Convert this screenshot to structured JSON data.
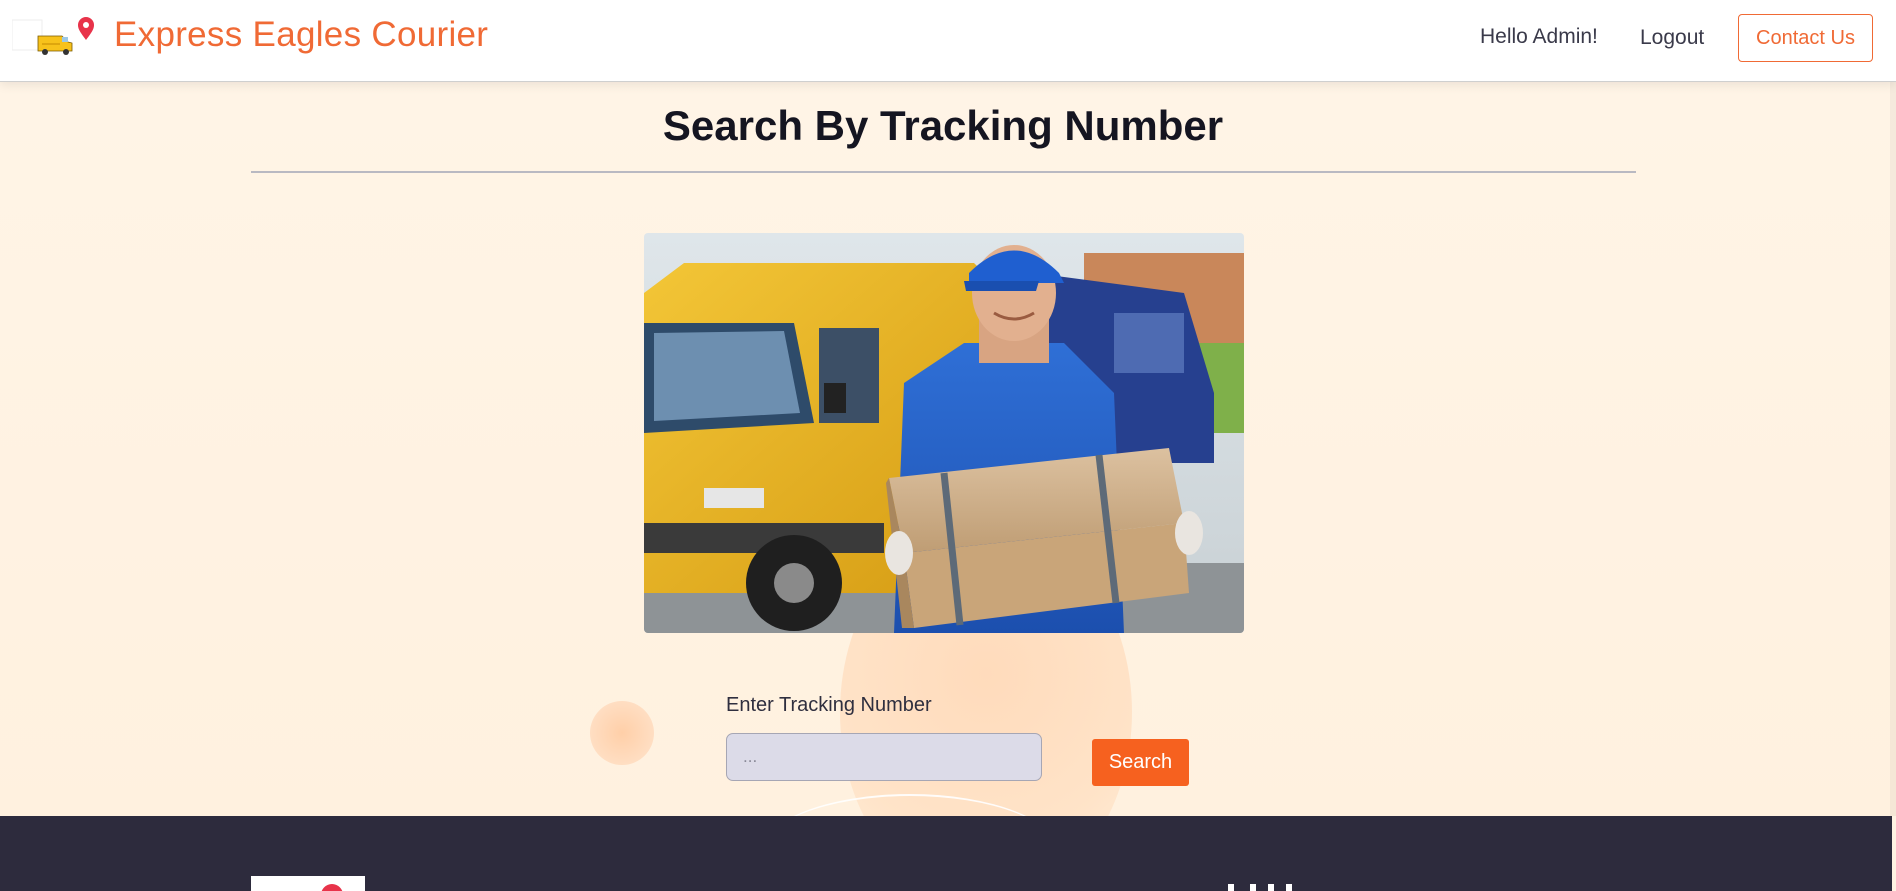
{
  "header": {
    "brand_name": "Express Eagles Courier",
    "logo_icon": "delivery-van-location-pin-logo",
    "greeting": "Hello Admin!",
    "logout_label": "Logout",
    "contact_label": "Contact Us"
  },
  "main": {
    "page_title": "Search By Tracking Number",
    "hero_image": "courier-holding-parcels-in-front-of-yellow-van",
    "form": {
      "label": "Enter Tracking Number",
      "placeholder": "...",
      "value": "",
      "submit_label": "Search"
    }
  },
  "footer": {
    "logo_icon": "footer-brand-logo"
  },
  "colors": {
    "brand": "#f06a35",
    "accent_button": "#f6611f",
    "page_background": "#fff3e2",
    "footer_background": "#2d2b3d",
    "input_background": "#dcdbe8",
    "title_text": "#151521"
  }
}
